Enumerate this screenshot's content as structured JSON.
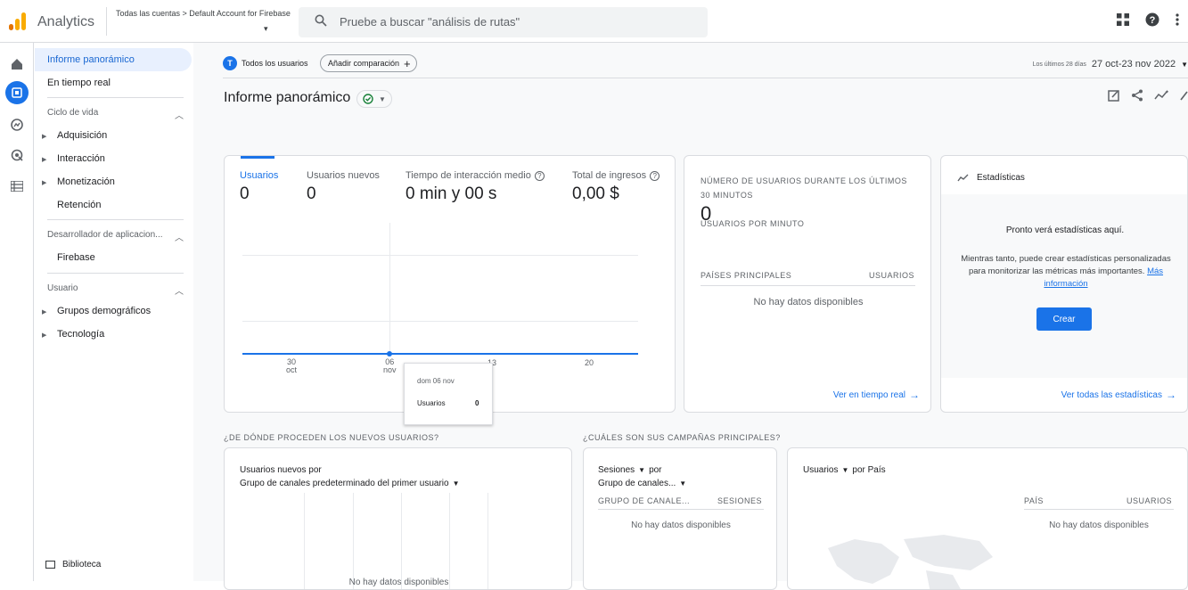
{
  "topbar": {
    "app_title": "Analytics",
    "account_breadcrumb": "Todas las cuentas > Default Account for Firebase",
    "search_placeholder": "Pruebe a buscar \"análisis de rutas\""
  },
  "sidebar": {
    "items": [
      {
        "label": "Informe panorámico",
        "active": true
      },
      {
        "label": "En tiempo real"
      }
    ],
    "sections": [
      {
        "title": "Ciclo de vida",
        "items": [
          "Adquisición",
          "Interacción",
          "Monetización",
          "Retención"
        ]
      },
      {
        "title": "Desarrollador de aplicacion...",
        "items": [
          "Firebase"
        ]
      },
      {
        "title": "Usuario",
        "items": [
          "Grupos demográficos",
          "Tecnología"
        ]
      }
    ],
    "library": "Biblioteca"
  },
  "filters": {
    "segment_initial": "T",
    "segment": "Todos los usuarios",
    "add_comparison": "Añadir comparación",
    "date_prefix": "Los últimos 28 días",
    "date_range": "27 oct-23 nov 2022"
  },
  "page": {
    "title": "Informe panorámico"
  },
  "metrics_card": {
    "metrics": [
      {
        "label": "Usuarios",
        "value": "0"
      },
      {
        "label": "Usuarios nuevos",
        "value": "0"
      },
      {
        "label": "Tiempo de interacción medio",
        "value": "0 min y 00 s"
      },
      {
        "label": "Total de ingresos",
        "value": "0,00 $"
      }
    ],
    "x_ticks": [
      {
        "top": "30",
        "bottom": "oct"
      },
      {
        "top": "06",
        "bottom": "nov"
      },
      {
        "top": "13",
        "bottom": ""
      },
      {
        "top": "20",
        "bottom": ""
      }
    ],
    "tooltip": {
      "date": "dom 06 nov",
      "label": "Usuarios",
      "value": "0"
    }
  },
  "realtime_card": {
    "title_line1": "NÚMERO DE USUARIOS DURANTE LOS ÚLTIMOS",
    "title_line2": "30 MINUTOS",
    "value": "0",
    "sub": "USUARIOS POR MINUTO",
    "col1": "PAÍSES PRINCIPALES",
    "col2": "USUARIOS",
    "empty": "No hay datos disponibles",
    "link": "Ver en tiempo real"
  },
  "insights_card": {
    "title": "Estadísticas",
    "heading": "Pronto verá estadísticas aquí.",
    "body": "Mientras tanto, puede crear estadísticas personalizadas para monitorizar las métricas más importantes.",
    "more": "Más información",
    "button": "Crear",
    "link": "Ver todas las estadísticas"
  },
  "section_titles": {
    "users_source": "¿DE DÓNDE PROCEDEN LOS NUEVOS USUARIOS?",
    "campaigns": "¿CUÁLES SON SUS CAMPAÑAS PRINCIPALES?"
  },
  "new_users_card": {
    "title_line1": "Usuarios nuevos por",
    "title_line2": "Grupo de canales predeterminado del primer usuario",
    "empty": "No hay datos disponibles"
  },
  "sessions_card": {
    "title_line1": "Sesiones",
    "title_by": "por",
    "title_line2": "Grupo de canales...",
    "col1": "GRUPO DE CANALE...",
    "col2": "SESIONES",
    "empty": "No hay datos disponibles"
  },
  "country_card": {
    "title_metric": "Usuarios",
    "title_by": "por País",
    "col1": "PAÍS",
    "col2": "USUARIOS",
    "empty": "No hay datos disponibles"
  },
  "colors": {
    "accent": "#1a73e8",
    "logo_orange": "#f9ab00",
    "logo_dark": "#e37400"
  }
}
